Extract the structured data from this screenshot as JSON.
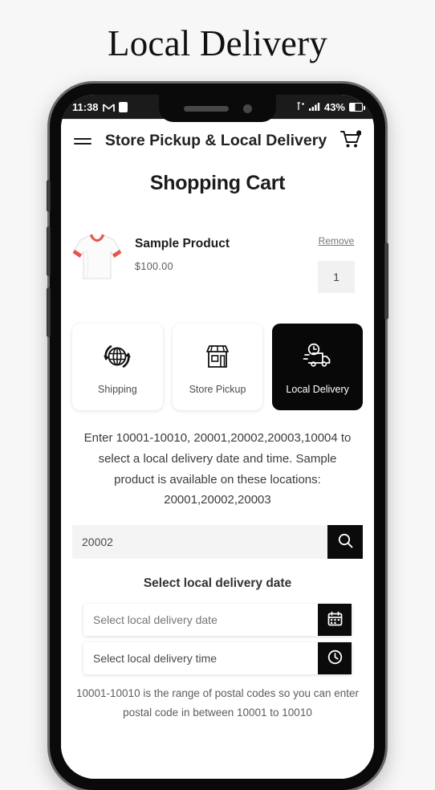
{
  "page": {
    "title": "Local Delivery",
    "background_color": "#f7f7f7"
  },
  "status_bar": {
    "time": "11:38",
    "gmail_icon": "gmail-icon",
    "app_icon": "app-icon",
    "network_icon": "network-indicator-icon",
    "signal_icon": "signal-bars-icon",
    "battery_percent": "43%",
    "battery_icon": "battery-icon"
  },
  "header": {
    "menu_icon": "hamburger-menu-icon",
    "title": "Store Pickup & Local Delivery",
    "cart_icon": "shopping-cart-icon"
  },
  "cart": {
    "heading": "Shopping Cart",
    "item": {
      "image_alt": "white t-shirt with red trim",
      "name": "Sample Product",
      "price": "$100.00",
      "remove_label": "Remove",
      "quantity": "1"
    }
  },
  "methods": {
    "options": [
      {
        "label": "Shipping",
        "icon": "globe-arrows-icon",
        "selected": false
      },
      {
        "label": "Store Pickup",
        "icon": "storefront-icon",
        "selected": false
      },
      {
        "label": "Local Delivery",
        "icon": "delivery-truck-clock-icon",
        "selected": true
      }
    ]
  },
  "instruction": {
    "text": "Enter 10001-10010, 20001,20002,20003,10004 to select a local delivery date and time. Sample product is available on these locations: 20001,20002,20003"
  },
  "postal_search": {
    "value": "20002",
    "placeholder": "Enter postal code",
    "search_icon": "search-icon"
  },
  "delivery": {
    "section_label": "Select local delivery date",
    "date_field": {
      "value": "",
      "placeholder": "Select local delivery date",
      "icon": "calendar-icon"
    },
    "time_field": {
      "value": "Select local delivery time",
      "placeholder": "Select local delivery time",
      "icon": "clock-icon"
    }
  },
  "footnote": {
    "text": "10001-10010 is the range of postal codes so you can enter postal code in between 10001 to 10010"
  },
  "colors": {
    "accent_black": "#080808",
    "page_bg": "#f7f7f7",
    "card_bg": "#ffffff",
    "input_bg": "#f4f4f4"
  }
}
